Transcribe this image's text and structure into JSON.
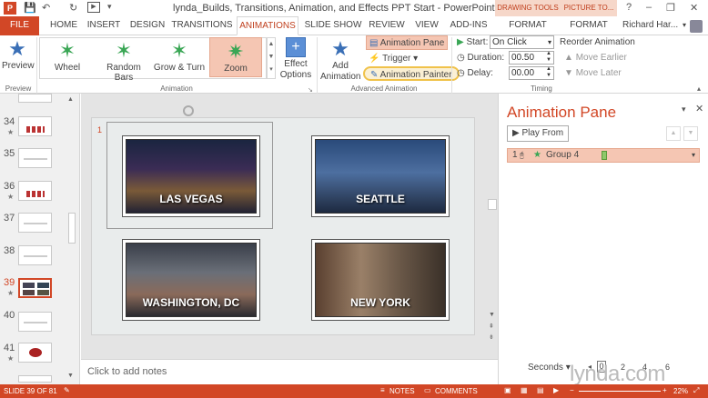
{
  "titlebar": {
    "title": "lynda_Builds, Transitions, Animation, and Effects PPT Start - PowerPoint",
    "context_drawing": "DRAWING TOOLS",
    "context_picture": "PICTURE TO...",
    "minimize": "–",
    "restore": "❐",
    "close": "✕",
    "help": "?"
  },
  "tabs": {
    "file": "FILE",
    "home": "HOME",
    "insert": "INSERT",
    "design": "DESIGN",
    "transitions": "TRANSITIONS",
    "animations": "ANIMATIONS",
    "slideshow": "SLIDE SHOW",
    "review": "REVIEW",
    "view": "VIEW",
    "addins": "ADD-INS",
    "format1": "FORMAT",
    "format2": "FORMAT",
    "user": "Richard Har..."
  },
  "ribbon": {
    "preview": "Preview",
    "preview_group": "Preview",
    "gallery": [
      "Wheel",
      "Random Bars",
      "Grow & Turn",
      "Zoom"
    ],
    "animation_group": "Animation",
    "effect_options": "Effect Options",
    "add_animation": "Add Animation",
    "animation_pane": "Animation Pane",
    "trigger": "Trigger",
    "animation_painter": "Animation Painter",
    "advanced_group": "Advanced Animation",
    "start_label": "Start:",
    "start_value": "On Click",
    "duration_label": "Duration:",
    "duration_value": "00.50",
    "delay_label": "Delay:",
    "delay_value": "00.00",
    "reorder": "Reorder Animation",
    "move_earlier": "Move Earlier",
    "move_later": "Move Later",
    "timing_group": "Timing"
  },
  "thumbs": [
    {
      "num": "34",
      "star": true
    },
    {
      "num": "35",
      "star": false
    },
    {
      "num": "36",
      "star": true
    },
    {
      "num": "37",
      "star": false
    },
    {
      "num": "38",
      "star": false
    },
    {
      "num": "39",
      "star": true,
      "selected": true
    },
    {
      "num": "40",
      "star": false
    },
    {
      "num": "41",
      "star": true
    }
  ],
  "slide": {
    "anim_tag": "1",
    "photos": [
      "LAS VEGAS",
      "SEATTLE",
      "WASHINGTON, DC",
      "NEW YORK"
    ]
  },
  "notes_placeholder": "Click to add notes",
  "pane": {
    "title": "Animation Pane",
    "play_from": "Play From",
    "item_num": "1",
    "item_label": "Group 4",
    "seconds": "Seconds",
    "timeline": [
      "0",
      "2",
      "4",
      "6"
    ]
  },
  "status": {
    "slide": "SLIDE 39 OF 81",
    "notes": "NOTES",
    "comments": "COMMENTS",
    "zoom": "22%"
  },
  "watermark": "lynda.com",
  "colors": {
    "accent": "#d24726",
    "selected_fill": "#f5c6b3",
    "star_green": "#3aa655"
  }
}
